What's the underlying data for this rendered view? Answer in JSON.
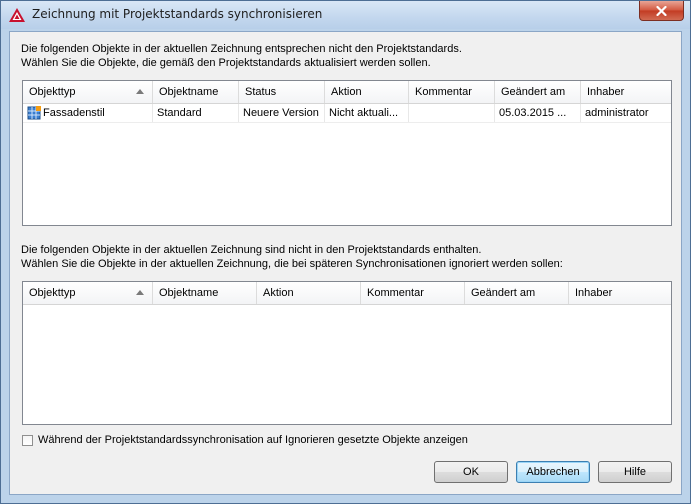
{
  "window": {
    "title": "Zeichnung mit Projektstandards synchronisieren"
  },
  "section1": {
    "line1": "Die folgenden Objekte in der aktuellen Zeichnung entsprechen nicht den Projektstandards.",
    "line2": "Wählen Sie die Objekte, die gemäß den Projektstandards aktualisiert werden sollen.",
    "columns": [
      "Objekttyp",
      "Objektname",
      "Status",
      "Aktion",
      "Kommentar",
      "Geändert am",
      "Inhaber"
    ],
    "rows": [
      {
        "objekttyp": "Fassadenstil",
        "objektname": "Standard",
        "status": "Neuere Version",
        "aktion": "Nicht aktuali...",
        "kommentar": "",
        "geaendert": "05.03.2015 ...",
        "inhaber": "administrator"
      }
    ]
  },
  "section2": {
    "line1": "Die folgenden Objekte in der aktuellen Zeichnung sind nicht in den Projektstandards enthalten.",
    "line2": "Wählen Sie die Objekte in der aktuellen Zeichnung, die bei späteren Synchronisationen ignoriert werden sollen:",
    "columns": [
      "Objekttyp",
      "Objektname",
      "Aktion",
      "Kommentar",
      "Geändert am",
      "Inhaber"
    ]
  },
  "checkbox": {
    "label": "Während der Projektstandardssynchronisation auf Ignorieren gesetzte Objekte anzeigen",
    "checked": false
  },
  "buttons": {
    "ok": "OK",
    "cancel": "Abbrechen",
    "help": "Hilfe"
  },
  "colors": {
    "accent": "#3c7fb1",
    "close": "#c23b22",
    "app_icon": "#c8102e"
  }
}
